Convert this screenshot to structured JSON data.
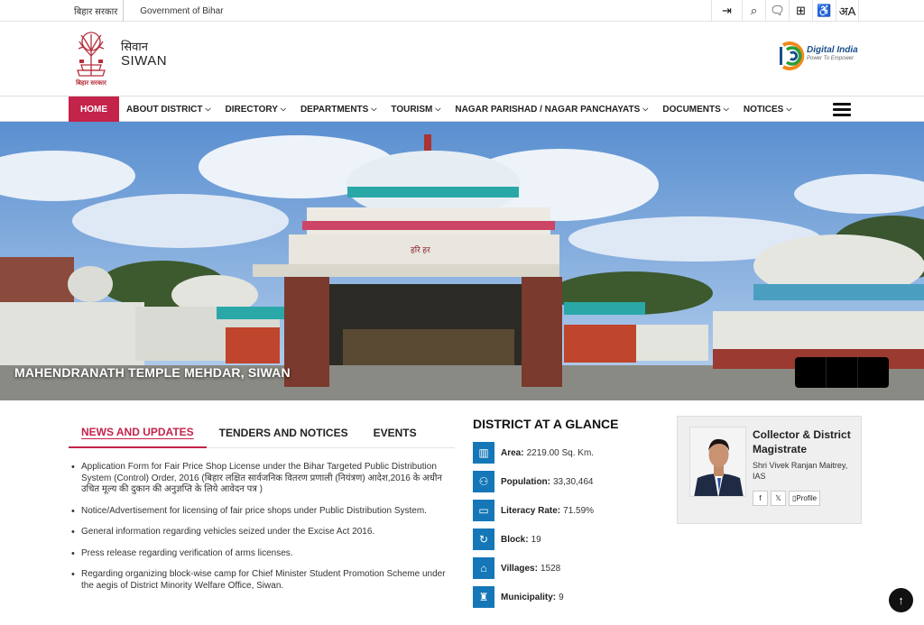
{
  "topbar": {
    "gov_hindi": "बिहार सरकार",
    "gov_english": "Government of Bihar",
    "tools": [
      {
        "icon": "skip-to-content-icon",
        "glyph": "⇥"
      },
      {
        "icon": "search-icon",
        "glyph": "⌕"
      },
      {
        "icon": "screen-reader-icon",
        "glyph": "🗨"
      },
      {
        "icon": "sitemap-icon",
        "glyph": "⊞"
      },
      {
        "icon": "accessibility-icon",
        "glyph": "♿"
      },
      {
        "icon": "language-icon",
        "glyph": "अA"
      }
    ]
  },
  "header": {
    "emblem_caption": "बिहार सरकार",
    "site_hindi": "सिवान",
    "site_name": "SIWAN",
    "digital_india": "Digital India",
    "digital_india_tagline": "Power To Empower"
  },
  "nav": {
    "items": [
      {
        "label": "HOME",
        "active": true,
        "dropdown": false
      },
      {
        "label": "ABOUT DISTRICT",
        "active": false,
        "dropdown": true
      },
      {
        "label": "DIRECTORY",
        "active": false,
        "dropdown": true
      },
      {
        "label": "DEPARTMENTS",
        "active": false,
        "dropdown": true
      },
      {
        "label": "TOURISM",
        "active": false,
        "dropdown": true
      },
      {
        "label": "NAGAR PARISHAD / NAGAR PANCHAYATS",
        "active": false,
        "dropdown": true
      },
      {
        "label": "DOCUMENTS",
        "active": false,
        "dropdown": true
      },
      {
        "label": "NOTICES",
        "active": false,
        "dropdown": true
      }
    ]
  },
  "hero": {
    "caption": "MAHENDRANATH TEMPLE MEHDAR, SIWAN",
    "temple_sign": "हरि हर"
  },
  "tabs": [
    {
      "label": "NEWS AND UPDATES",
      "active": true
    },
    {
      "label": "TENDERS AND NOTICES",
      "active": false
    },
    {
      "label": "EVENTS",
      "active": false
    }
  ],
  "news": [
    "Application Form for Fair Price Shop License under the Bihar Targeted Public Distribution System (Control) Order, 2016 (बिहार लक्षित सार्वजनिक वितरण प्रणाली (नियंत्रण) आदेश,2016 के अधीन उचित मूल्य की दुकान की अनुज्ञप्ति के लिये आवेदन पत्र )",
    "Notice/Advertisement for licensing of fair price shops under Public Distribution System.",
    "General information regarding vehicles seized under the Excise Act 2016.",
    "Press release regarding verification of arms licenses.",
    "Regarding organizing block-wise camp for Chief Minister Student Promotion Scheme under the aegis of District Minority Welfare Office, Siwan."
  ],
  "glance": {
    "title": "DISTRICT AT A GLANCE",
    "items": [
      {
        "icon": "map-icon",
        "glyph": "▥",
        "label": "Area:",
        "value": "2219.00 Sq. Km."
      },
      {
        "icon": "population-icon",
        "glyph": "⚇",
        "label": "Population:",
        "value": "33,30,464"
      },
      {
        "icon": "book-icon",
        "glyph": "▭",
        "label": "Literacy Rate:",
        "value": "71.59%"
      },
      {
        "icon": "block-icon",
        "glyph": "↻",
        "label": "Block:",
        "value": "19"
      },
      {
        "icon": "village-icon",
        "glyph": "⌂",
        "label": "Villages:",
        "value": "1528"
      },
      {
        "icon": "municipality-icon",
        "glyph": "♜",
        "label": "Municipality:",
        "value": "9"
      }
    ]
  },
  "collector": {
    "title": "Collector & District Magistrate",
    "name": "Shri Vivek Ranjan Maitrey, IAS",
    "facebook": "f",
    "x": "𝕏",
    "profile": "Profile"
  },
  "scroll_top": "↑",
  "colors": {
    "accent": "#c4234a",
    "glance_icon": "#1577b8"
  }
}
